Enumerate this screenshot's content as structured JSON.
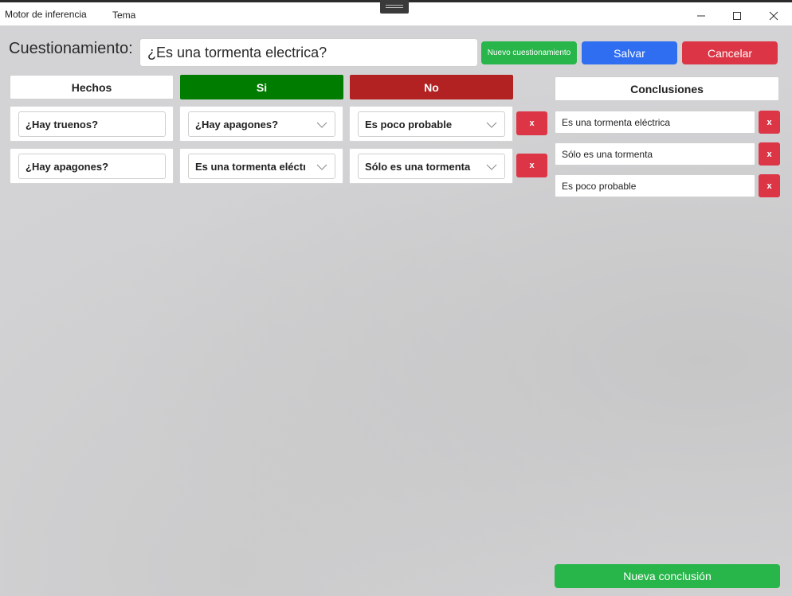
{
  "window": {
    "title": "Motor de inferencia",
    "menu": "Tema"
  },
  "question": {
    "label": "Cuestionamiento:",
    "value": "¿Es una tormenta electrica?"
  },
  "buttons": {
    "nuevo_cuestionamiento": "Nuevo cuestionamiento",
    "salvar": "Salvar",
    "cancelar": "Cancelar",
    "nueva_conclusion": "Nueva conclusión",
    "remove": "x"
  },
  "columns": {
    "hechos": "Hechos",
    "si": "Si",
    "no": "No",
    "conclusiones": "Conclusiones"
  },
  "rules": [
    {
      "hecho": "¿Hay truenos?",
      "si": "¿Hay apagones?",
      "no": "Es poco probable"
    },
    {
      "hecho": "¿Hay apagones?",
      "si": "Es una tormenta eléctrica",
      "no": "Sólo es una tormenta"
    }
  ],
  "conclusions": [
    "Es una tormenta eléctrica",
    "Sólo es una tormenta",
    "Es poco probable"
  ],
  "colors": {
    "si_header": "#007d00",
    "no_header": "#b22222",
    "green_button": "#28b54a",
    "blue_button": "#2f6ef0",
    "red_button": "#dc3545",
    "background": "#d3d3d5"
  },
  "icons": {
    "minimize": "minimize-icon",
    "maximize": "maximize-icon",
    "close": "close-icon",
    "dropdown": "chevron-down-icon"
  }
}
